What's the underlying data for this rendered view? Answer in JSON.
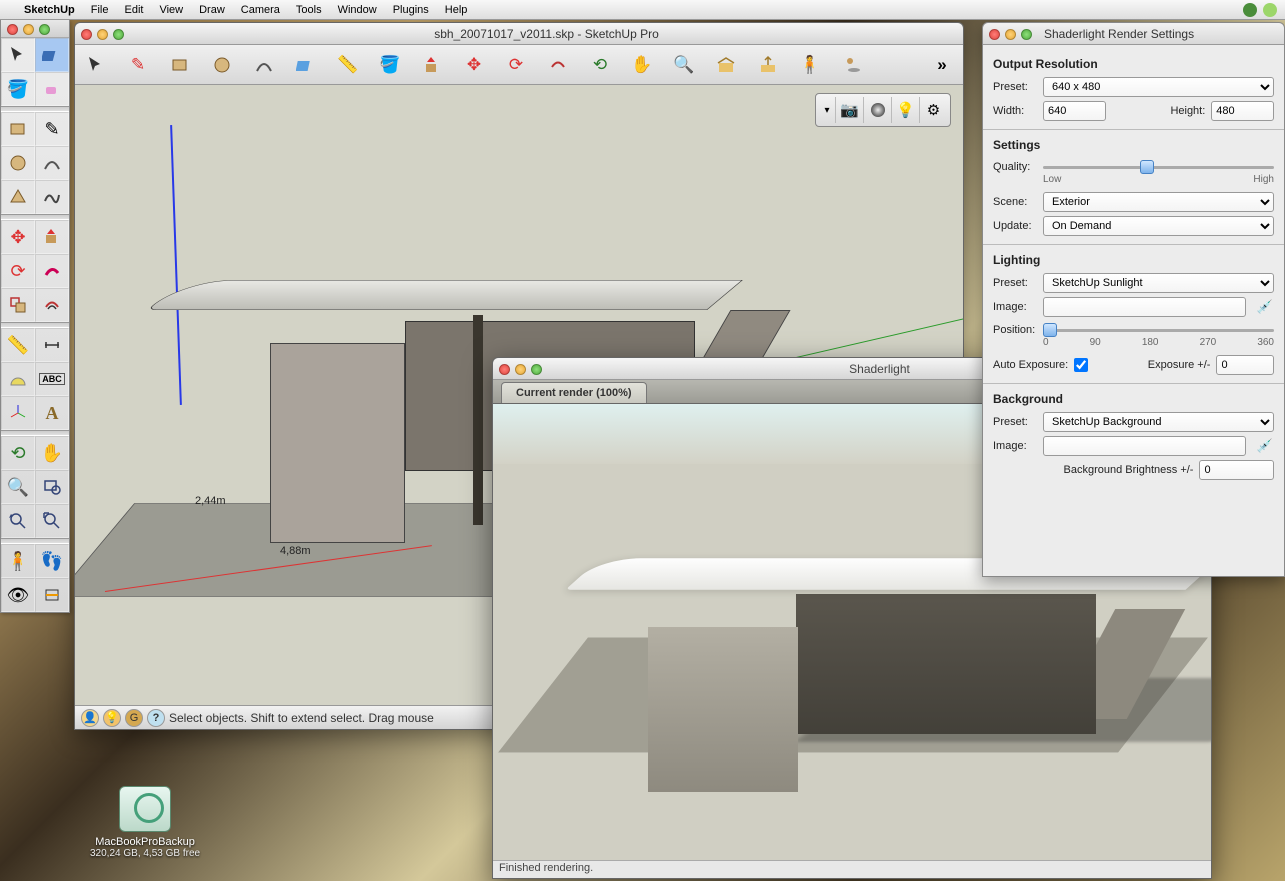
{
  "menubar": {
    "app": "SketchUp",
    "items": [
      "File",
      "Edit",
      "View",
      "Draw",
      "Camera",
      "Tools",
      "Window",
      "Plugins",
      "Help"
    ]
  },
  "window": {
    "title": "sbh_20071017_v2011.skp - SketchUp Pro",
    "status": "Select objects. Shift to extend select. Drag mouse",
    "dim1": "2,44m",
    "dim2": "4,88m"
  },
  "render": {
    "title": "Shaderlight",
    "tab": "Current render (100%)",
    "status": "Finished rendering."
  },
  "settings": {
    "title": "Shaderlight Render Settings",
    "sections": {
      "res": "Output Resolution",
      "settings": "Settings",
      "lighting": "Lighting",
      "bg": "Background"
    },
    "labels": {
      "preset": "Preset:",
      "width": "Width:",
      "height": "Height:",
      "quality": "Quality:",
      "low": "Low",
      "high": "High",
      "scene": "Scene:",
      "update": "Update:",
      "image": "Image:",
      "position": "Position:",
      "autoexp": "Auto Exposure:",
      "exposure": "Exposure +/-",
      "bgbright": "Background Brightness +/-"
    },
    "values": {
      "res_preset": "640 x 480",
      "width": "640",
      "height": "480",
      "scene": "Exterior",
      "update": "On Demand",
      "light_preset": "SketchUp Sunlight",
      "light_image": "",
      "exposure": "0",
      "bg_preset": "SketchUp Background",
      "bg_image": "",
      "bg_bright": "0"
    },
    "ticks": [
      "0",
      "90",
      "180",
      "270",
      "360"
    ]
  },
  "desktop": {
    "name": "MacBookProBackup",
    "sub": "320,24 GB, 4,53 GB free"
  }
}
